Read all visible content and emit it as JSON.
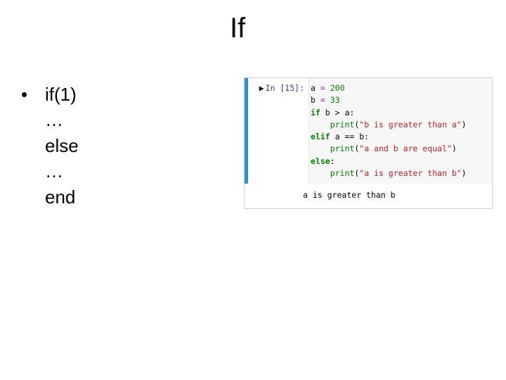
{
  "title": "If",
  "bullet": {
    "marker": "•",
    "lines": [
      "if(1)",
      "…",
      "else",
      "…",
      "end"
    ]
  },
  "notebook": {
    "prompt": "In [15]:",
    "code": {
      "l1_a": "a",
      "l1_eq": " = ",
      "l1_200": "200",
      "l2_b": "b",
      "l2_eq": " = ",
      "l2_33": "33",
      "l3_if": "if",
      "l3_rest": " b > a:",
      "l4_pad": "    ",
      "l4_fn": "print",
      "l4_open": "(",
      "l4_str": "\"b is greater than a\"",
      "l4_close": ")",
      "l5_elif": "elif",
      "l5_rest": " a == b:",
      "l6_pad": "    ",
      "l6_fn": "print",
      "l6_open": "(",
      "l6_str": "\"a and b are equal\"",
      "l6_close": ")",
      "l7_else": "else",
      "l7_colon": ":",
      "l8_pad": "    ",
      "l8_fn": "print",
      "l8_open": "(",
      "l8_str": "\"a is greater than b\"",
      "l8_close": ")"
    },
    "output": "a is greater than b"
  }
}
